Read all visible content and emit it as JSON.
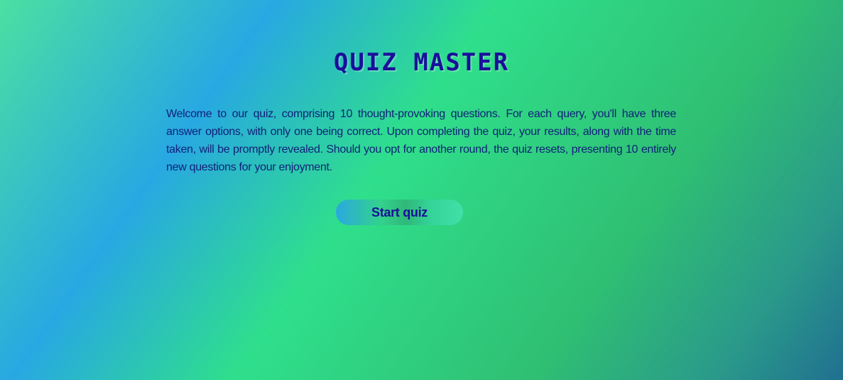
{
  "header": {
    "title": "QUIZ MASTER"
  },
  "main": {
    "intro": "Welcome to our quiz, comprising 10 thought-provoking questions. For each query, you'll have three answer options, with only one being correct. Upon completing the quiz, your results, along with the time taken, will be promptly revealed. Should you opt for another round, the quiz resets, presenting 10 entirely new questions for your enjoyment.",
    "start_label": "Start quiz"
  },
  "colors": {
    "title": "#1a0f9a",
    "text": "#12207a",
    "background_green": "#2fdf8b",
    "background_blue": "#28a8e2"
  }
}
